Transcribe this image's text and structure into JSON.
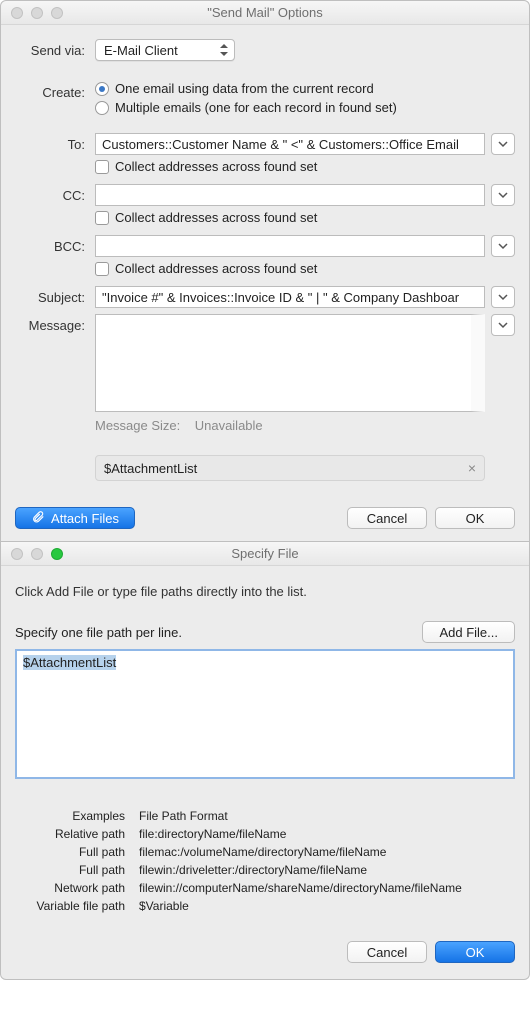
{
  "window1": {
    "title": "\"Send Mail\" Options",
    "sendVia": {
      "label": "Send via:",
      "value": "E-Mail Client"
    },
    "create": {
      "label": "Create:",
      "optionOne": "One email using data from the current record",
      "optionMultiple": "Multiple emails (one for each record in found set)"
    },
    "to": {
      "label": "To:",
      "value": "Customers::Customer Name & \" <\" & Customers::Office Email",
      "collect": "Collect addresses across found set"
    },
    "cc": {
      "label": "CC:",
      "value": "",
      "collect": "Collect addresses across found set"
    },
    "bcc": {
      "label": "BCC:",
      "value": "",
      "collect": "Collect addresses across found set"
    },
    "subject": {
      "label": "Subject:",
      "value": "\"Invoice #\" & Invoices::Invoice ID & \" | \" & Company Dashboar"
    },
    "message": {
      "label": "Message:",
      "sizeLabel": "Message Size:",
      "sizeValue": "Unavailable"
    },
    "attachment": "$AttachmentList",
    "buttons": {
      "attach": "Attach Files",
      "cancel": "Cancel",
      "ok": "OK"
    }
  },
  "window2": {
    "title": "Specify File",
    "help": "Click Add File or type file paths directly into the list.",
    "specifyLabel": "Specify one file path per line.",
    "addFile": "Add File...",
    "pathText": "$AttachmentList",
    "examples": {
      "header1": "Examples",
      "header2": "File Path Format",
      "rows": [
        {
          "label": "Relative path",
          "value": "file:directoryName/fileName"
        },
        {
          "label": "Full path",
          "value": "filemac:/volumeName/directoryName/fileName"
        },
        {
          "label": "Full path",
          "value": "filewin:/driveletter:/directoryName/fileName"
        },
        {
          "label": "Network path",
          "value": "filewin://computerName/shareName/directoryName/fileName"
        },
        {
          "label": "Variable file path",
          "value": "$Variable"
        }
      ]
    },
    "buttons": {
      "cancel": "Cancel",
      "ok": "OK"
    }
  }
}
